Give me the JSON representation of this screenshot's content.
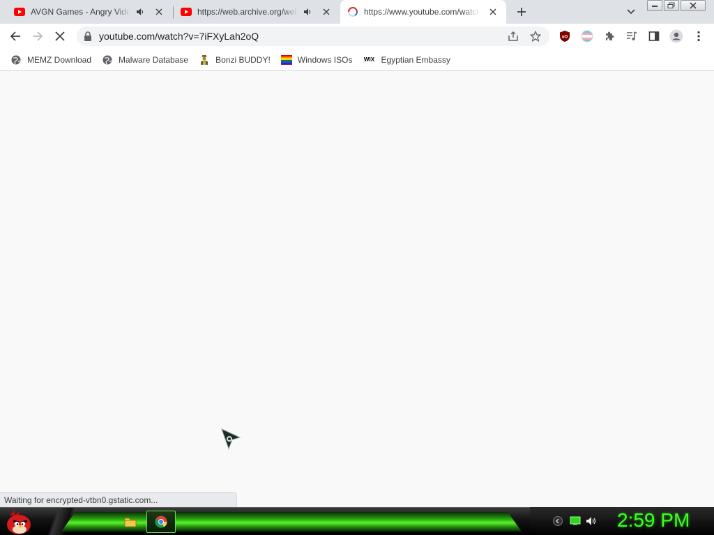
{
  "browser": {
    "tabs": [
      {
        "title": "AVGN Games - Angry Video",
        "favicon": "youtube-icon",
        "audio": true,
        "active": false
      },
      {
        "title": "https://web.archive.org/web/",
        "favicon": "youtube-icon",
        "audio": true,
        "active": false
      },
      {
        "title": "https://www.youtube.com/watch",
        "favicon": "loading-spinner-icon",
        "audio": false,
        "active": true
      }
    ],
    "new_tab_symbol": "+",
    "address": "youtube.com/watch?v=7iFXyLah2oQ",
    "bookmarks": [
      {
        "label": "MEMZ Download",
        "icon": "globe-icon"
      },
      {
        "label": "Malware Database",
        "icon": "globe-icon"
      },
      {
        "label": "Bonzi BUDDY!",
        "icon": "bonzi-icon"
      },
      {
        "label": "Windows ISOs",
        "icon": "rainbow-flag-icon"
      },
      {
        "label": "Egyptian Embassy",
        "icon": "wix-icon",
        "icon_text": "WIX"
      }
    ],
    "status_text": "Waiting for encrypted-vtbn0.gstatic.com..."
  },
  "taskbar": {
    "clock": "2:59 PM",
    "apps": [
      "file-explorer-icon",
      "chrome-icon"
    ]
  },
  "colors": {
    "tab_strip": "#dee1e6",
    "clock_green": "#3dff25",
    "youtube_red": "#ff0000",
    "ublock_red": "#800000"
  }
}
